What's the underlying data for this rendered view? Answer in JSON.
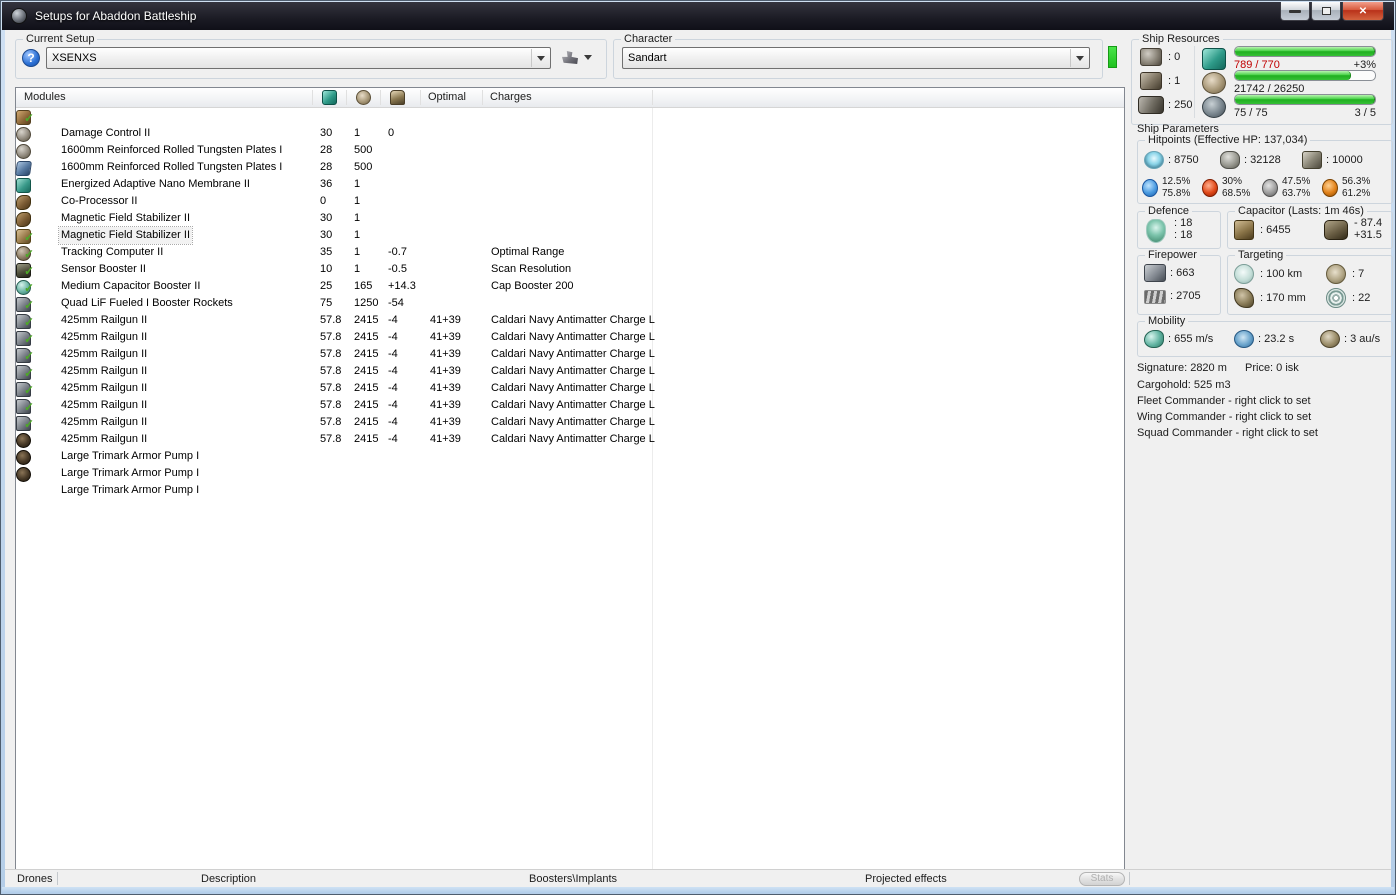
{
  "window": {
    "title": "Setups for Abaddon Battleship"
  },
  "toolbar": {
    "setup_group": "Current Setup",
    "setup_value": "XSENXS",
    "character_group": "Character",
    "character_value": "Sandart"
  },
  "table": {
    "col_modules": "Modules",
    "col_optimal": "Optimal",
    "col_charges": "Charges",
    "rows": [
      {
        "checked": true,
        "focused": false,
        "icon": "damage-control",
        "name": "Damage Control II",
        "cpu": "30",
        "pg": "1",
        "cap": "0",
        "optimal": "",
        "charge": ""
      },
      {
        "checked": false,
        "focused": false,
        "icon": "armor-plate",
        "name": "1600mm Reinforced Rolled Tungsten Plates I",
        "cpu": "28",
        "pg": "500",
        "cap": "",
        "optimal": "",
        "charge": ""
      },
      {
        "checked": false,
        "focused": false,
        "icon": "armor-plate",
        "name": "1600mm Reinforced Rolled Tungsten Plates I",
        "cpu": "28",
        "pg": "500",
        "cap": "",
        "optimal": "",
        "charge": ""
      },
      {
        "checked": false,
        "focused": false,
        "icon": "nano-membrane",
        "name": "Energized Adaptive Nano Membrane II",
        "cpu": "36",
        "pg": "1",
        "cap": "",
        "optimal": "",
        "charge": ""
      },
      {
        "checked": false,
        "focused": false,
        "icon": "co-processor",
        "name": "Co-Processor II",
        "cpu": "0",
        "pg": "1",
        "cap": "",
        "optimal": "",
        "charge": ""
      },
      {
        "checked": false,
        "focused": false,
        "icon": "mag-stab",
        "name": "Magnetic Field Stabilizer II",
        "cpu": "30",
        "pg": "1",
        "cap": "",
        "optimal": "",
        "charge": ""
      },
      {
        "checked": false,
        "focused": true,
        "icon": "mag-stab",
        "name": "Magnetic Field Stabilizer II",
        "cpu": "30",
        "pg": "1",
        "cap": "",
        "optimal": "",
        "charge": ""
      },
      {
        "checked": true,
        "focused": false,
        "icon": "tracking-computer",
        "name": "Tracking Computer II",
        "cpu": "35",
        "pg": "1",
        "cap": "-0.7",
        "optimal": "",
        "charge": "Optimal Range"
      },
      {
        "checked": true,
        "focused": false,
        "icon": "sensor-booster",
        "name": "Sensor Booster II",
        "cpu": "10",
        "pg": "1",
        "cap": "-0.5",
        "optimal": "",
        "charge": "Scan Resolution"
      },
      {
        "checked": true,
        "focused": false,
        "icon": "cap-booster",
        "name": "Medium Capacitor Booster II",
        "cpu": "25",
        "pg": "165",
        "cap": "+14.3",
        "optimal": "",
        "charge": "Cap Booster 200"
      },
      {
        "checked": true,
        "focused": false,
        "icon": "booster-rockets",
        "name": "Quad LiF Fueled I Booster Rockets",
        "cpu": "75",
        "pg": "1250",
        "cap": "-54",
        "optimal": "",
        "charge": ""
      },
      {
        "checked": true,
        "focused": false,
        "icon": "railgun",
        "name": "425mm Railgun II",
        "cpu": "57.8",
        "pg": "2415",
        "cap": "-4",
        "optimal": "41+39",
        "charge": "Caldari Navy Antimatter Charge L"
      },
      {
        "checked": true,
        "focused": false,
        "icon": "railgun",
        "name": "425mm Railgun II",
        "cpu": "57.8",
        "pg": "2415",
        "cap": "-4",
        "optimal": "41+39",
        "charge": "Caldari Navy Antimatter Charge L"
      },
      {
        "checked": true,
        "focused": false,
        "icon": "railgun",
        "name": "425mm Railgun II",
        "cpu": "57.8",
        "pg": "2415",
        "cap": "-4",
        "optimal": "41+39",
        "charge": "Caldari Navy Antimatter Charge L"
      },
      {
        "checked": true,
        "focused": false,
        "icon": "railgun",
        "name": "425mm Railgun II",
        "cpu": "57.8",
        "pg": "2415",
        "cap": "-4",
        "optimal": "41+39",
        "charge": "Caldari Navy Antimatter Charge L"
      },
      {
        "checked": true,
        "focused": false,
        "icon": "railgun",
        "name": "425mm Railgun II",
        "cpu": "57.8",
        "pg": "2415",
        "cap": "-4",
        "optimal": "41+39",
        "charge": "Caldari Navy Antimatter Charge L"
      },
      {
        "checked": true,
        "focused": false,
        "icon": "railgun",
        "name": "425mm Railgun II",
        "cpu": "57.8",
        "pg": "2415",
        "cap": "-4",
        "optimal": "41+39",
        "charge": "Caldari Navy Antimatter Charge L"
      },
      {
        "checked": true,
        "focused": false,
        "icon": "railgun",
        "name": "425mm Railgun II",
        "cpu": "57.8",
        "pg": "2415",
        "cap": "-4",
        "optimal": "41+39",
        "charge": "Caldari Navy Antimatter Charge L"
      },
      {
        "checked": true,
        "focused": false,
        "icon": "railgun",
        "name": "425mm Railgun II",
        "cpu": "57.8",
        "pg": "2415",
        "cap": "-4",
        "optimal": "41+39",
        "charge": "Caldari Navy Antimatter Charge L"
      },
      {
        "checked": false,
        "focused": false,
        "icon": "rig",
        "name": "Large Trimark Armor Pump I",
        "cpu": "",
        "pg": "",
        "cap": "",
        "optimal": "",
        "charge": ""
      },
      {
        "checked": false,
        "focused": false,
        "icon": "rig",
        "name": "Large Trimark Armor Pump I",
        "cpu": "",
        "pg": "",
        "cap": "",
        "optimal": "",
        "charge": ""
      },
      {
        "checked": false,
        "focused": false,
        "icon": "rig",
        "name": "Large Trimark Armor Pump I",
        "cpu": "",
        "pg": "",
        "cap": "",
        "optimal": "",
        "charge": ""
      }
    ]
  },
  "resources": {
    "title": "Ship Resources",
    "turrets": ": 0",
    "launchers": ": 1",
    "calibration": ": 250",
    "cpu": {
      "text": "789 / 770",
      "extra": "+3%",
      "fill": 100
    },
    "powergrid": {
      "text": "21742 / 26250",
      "extra": "",
      "fill": 83
    },
    "drones": {
      "text": "75 / 75",
      "extra": "3 / 5",
      "fill": 100
    }
  },
  "parameters": {
    "title": "Ship Parameters",
    "hitpoints": {
      "title": "Hitpoints (Effective HP: 137,034)",
      "shield": ": 8750",
      "armor": ": 32128",
      "structure": ": 10000",
      "resists": [
        {
          "kind": "em",
          "top": "12.5%",
          "bottom": "75.8%"
        },
        {
          "kind": "thermal",
          "top": "30%",
          "bottom": "68.5%"
        },
        {
          "kind": "kinetic",
          "top": "47.5%",
          "bottom": "63.7%"
        },
        {
          "kind": "explosive",
          "top": "56.3%",
          "bottom": "61.2%"
        }
      ]
    },
    "defence": {
      "title": "Defence",
      "line1": ": 18",
      "line2": ": 18"
    },
    "capacitor": {
      "title": "Capacitor (Lasts: 1m 46s)",
      "amount": ": 6455",
      "drain": "- 87.4",
      "boost": "+31.5"
    },
    "firepower": {
      "title": "Firepower",
      "volley": ": 663",
      "dps": ": 2705"
    },
    "targeting": {
      "title": "Targeting",
      "range": ": 100 km",
      "sig_resolution": ": 170 mm",
      "max_targets": ": 7",
      "scan_res": ": 22"
    },
    "mobility": {
      "title": "Mobility",
      "speed": ": 655 m/s",
      "align": ": 23.2 s",
      "warp": ": 3 au/s"
    },
    "info": {
      "signature": "Signature: 2820 m",
      "price": "Price: 0 isk",
      "cargohold": "Cargohold: 525 m3",
      "fleet": "Fleet Commander - right click to set",
      "wing": "Wing Commander - right click to set",
      "squad": "Squad Commander - right click to set"
    }
  },
  "bottom": {
    "drones": "Drones",
    "description": "Description",
    "boosters": "Boosters\\Implants",
    "projected": "Projected effects",
    "stats": "Stats"
  },
  "colors": {
    "over_cpu_text": "#c00000",
    "bar_green": "#2fc52f",
    "character_status_green": "#2fdd2f"
  }
}
